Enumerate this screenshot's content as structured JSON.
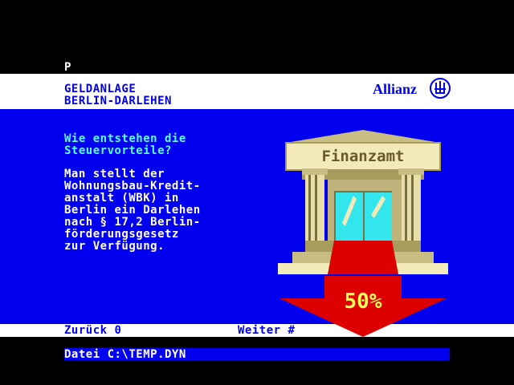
{
  "page_indicator": "P",
  "header": {
    "title_line1": "GELDANLAGE",
    "title_line2": "BERLIN-DARLEHEN",
    "brand": "Allianz",
    "logo_icon": "allianz-eagle-icon"
  },
  "content": {
    "question": "Wie entstehen die\nSteuervorteile?",
    "answer": "Man stellt der\nWohnungsbau-Kredit-\nanstalt (WBK) in\nBerlin ein Darlehen\nnach § 17,2 Berlin-\nförderungsgesetz\nzur Verfügung."
  },
  "illustration": {
    "building_sign": "Finanzamt",
    "arrow_label": "50%"
  },
  "nav": {
    "back_label": "Zurück 0",
    "next_label": "Weiter #"
  },
  "status": {
    "file_label": "Datei C:\\TEMP.DYN"
  },
  "colors": {
    "background": "#000000",
    "panel_blue": "#0000ee",
    "question_cyan": "#55ffff",
    "arrow_red": "#dd0000",
    "arrow_text": "#ffff55"
  }
}
